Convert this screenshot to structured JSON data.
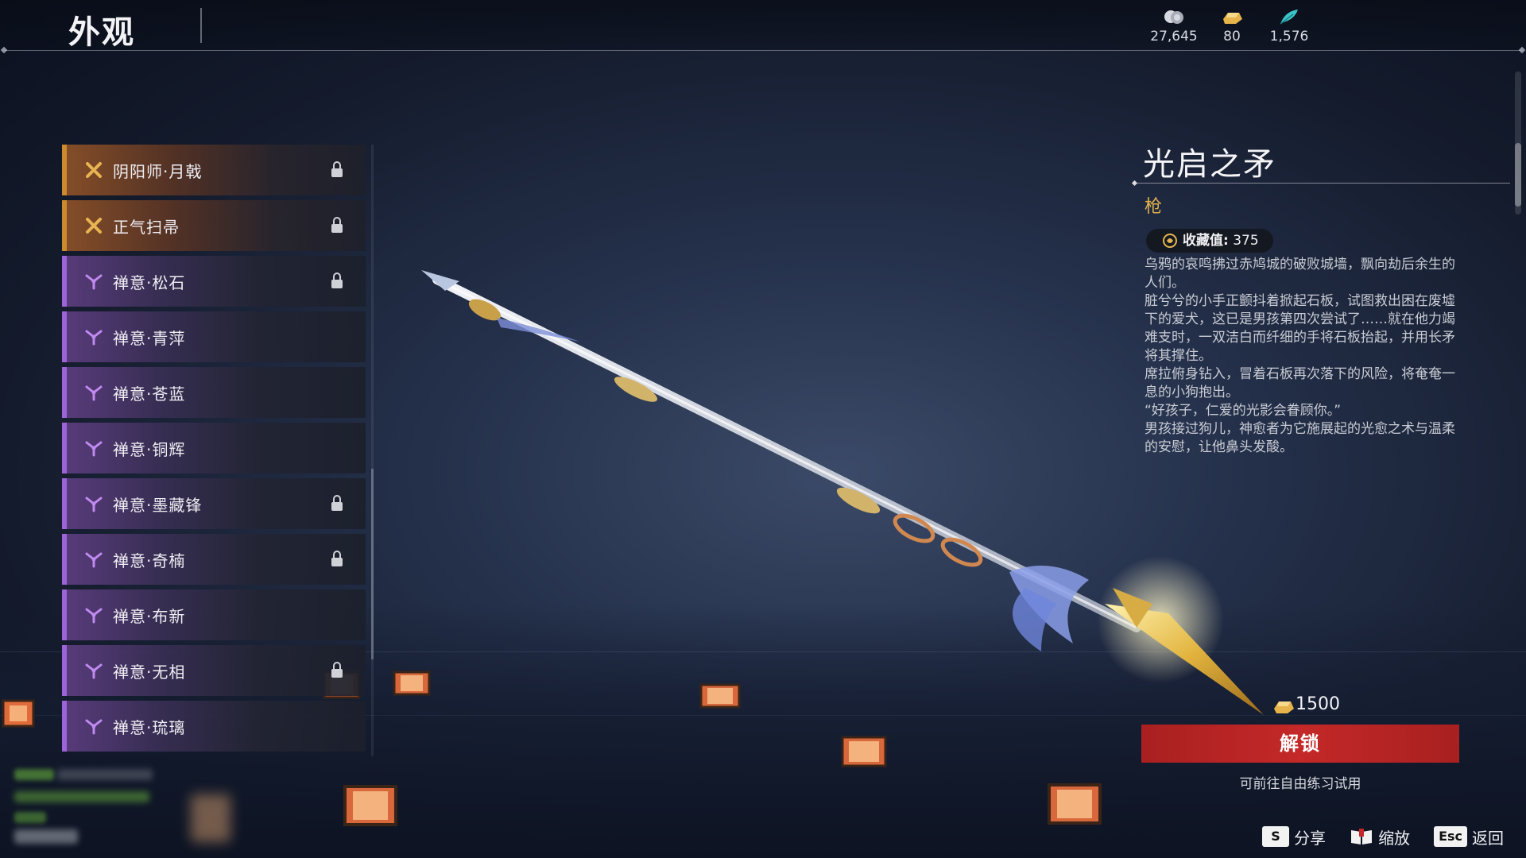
{
  "header": {
    "title": "外观",
    "currencies": [
      {
        "icon": "silver-coin-icon",
        "value": "27,645"
      },
      {
        "icon": "gold-ingot-icon",
        "value": "80"
      },
      {
        "icon": "feather-icon",
        "value": "1,576"
      }
    ]
  },
  "items": [
    {
      "label": "阴阳师·月戟",
      "rarity": "orange",
      "locked": true
    },
    {
      "label": "正气扫帚",
      "rarity": "orange",
      "locked": true
    },
    {
      "label": "禅意·松石",
      "rarity": "purple",
      "locked": true
    },
    {
      "label": "禅意·青萍",
      "rarity": "purple",
      "locked": false
    },
    {
      "label": "禅意·苍蓝",
      "rarity": "purple",
      "locked": false
    },
    {
      "label": "禅意·铜辉",
      "rarity": "purple",
      "locked": false
    },
    {
      "label": "禅意·墨藏锋",
      "rarity": "purple",
      "locked": true
    },
    {
      "label": "禅意·奇楠",
      "rarity": "purple",
      "locked": true
    },
    {
      "label": "禅意·布新",
      "rarity": "purple",
      "locked": false
    },
    {
      "label": "禅意·无相",
      "rarity": "purple",
      "locked": true
    },
    {
      "label": "禅意·琉璃",
      "rarity": "purple",
      "locked": false
    }
  ],
  "detail": {
    "name": "光启之矛",
    "type": "枪",
    "collect_label": "收藏值:",
    "collect_value": "375",
    "description": [
      "乌鸦的哀鸣拂过赤鸠城的破败城墙，飘向劫后余生的人们。",
      "脏兮兮的小手正颤抖着掀起石板，试图救出困在废墟下的爱犬，这已是男孩第四次尝试了……就在他力竭难支时，一双洁白而纤细的手将石板抬起，并用长矛将其撑住。",
      "席拉俯身钻入，冒着石板再次落下的风险，将奄奄一息的小狗抱出。",
      "“好孩子，仁爱的光影会眷顾你。”",
      "男孩接过狗儿，神愈者为它施展起的光愈之术与温柔的安慰，让他鼻头发酸。"
    ],
    "price": "1500",
    "unlock_label": "解锁",
    "trial_hint": "可前往自由练习试用"
  },
  "hotkeys": [
    {
      "key": "S",
      "label": "分享"
    },
    {
      "key": "book-icon",
      "label": "缩放"
    },
    {
      "key": "Esc",
      "label": "返回"
    }
  ],
  "colors": {
    "orange_rarity": "#cc8a2e",
    "purple_rarity": "#9c64d8",
    "unlock_red": "#c42828",
    "type_gold": "#e1b04e"
  }
}
